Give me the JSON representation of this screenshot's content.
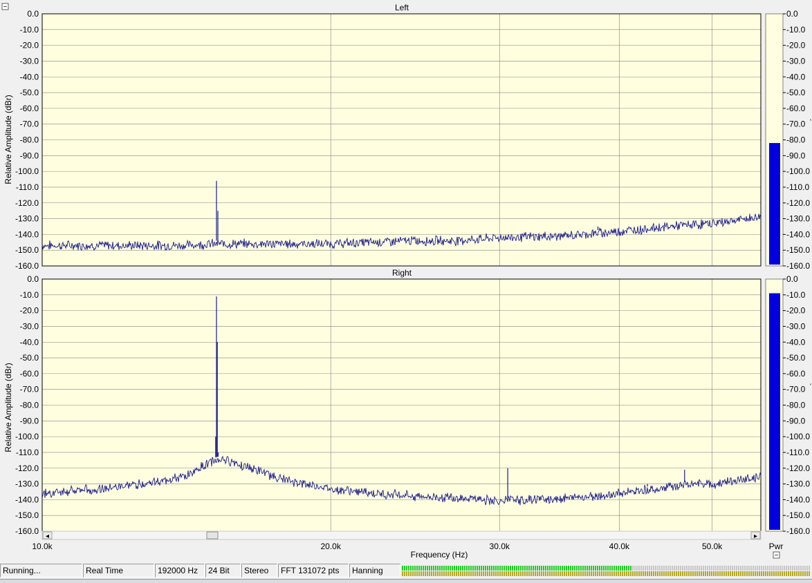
{
  "window": {
    "collapse_glyph": "−",
    "bottom_toggle_glyph": "−",
    "scroll_left_glyph": "◂",
    "scroll_right_glyph": "▸",
    "power_label": "Pwr",
    "xlabel": "Frequency (Hz)",
    "x_tick_labels": [
      "10.0k",
      "20.0k",
      "30.0k",
      "40.0k",
      "50.0k"
    ]
  },
  "colors": {
    "plot_background": "#ffffe0",
    "panel_background": "#f0f0f0",
    "grid": "#808080",
    "trace": "#1a1a8c",
    "meter_bar": "#0000e0",
    "level_green": "#22cc22",
    "level_olive": "#b4a824"
  },
  "status": {
    "running": "Running...",
    "mode": "Real Time",
    "sample_rate": "192000 Hz",
    "bit_depth": "24 Bit",
    "channels": "Stereo",
    "fft_size": "FFT 131072 pts",
    "window_fn": "Hanning",
    "input_level_fraction": 0.56
  },
  "chart_data": [
    {
      "type": "line",
      "title": "Left",
      "xlabel": "Frequency (Hz)",
      "ylabel": "Relative Amplitude (dBr)",
      "xlim": [
        10000,
        56200
      ],
      "ylim": [
        -160,
        0
      ],
      "x_scale": "log",
      "grid": true,
      "x_ticks": [
        10000,
        20000,
        30000,
        40000,
        50000
      ],
      "y_tick_labels": [
        "0.0",
        "-10.0",
        "-20.0",
        "-30.0",
        "-40.0",
        "-50.0",
        "-60.0",
        "-70.0",
        "-80.0",
        "-90.0",
        "-100.0",
        "-110.0",
        "-120.0",
        "-130.0",
        "-140.0",
        "-150.0",
        "-160.0"
      ],
      "series": [
        {
          "points": [
            [
              10000,
              -147
            ],
            [
              12000,
              -147
            ],
            [
              14000,
              -147
            ],
            [
              15000,
              -146
            ],
            [
              15200,
              -106
            ],
            [
              15400,
              -146
            ],
            [
              17000,
              -146
            ],
            [
              20000,
              -146
            ],
            [
              24000,
              -144
            ],
            [
              27000,
              -144
            ],
            [
              30000,
              -142
            ],
            [
              35000,
              -141
            ],
            [
              38000,
              -139
            ],
            [
              40000,
              -138
            ],
            [
              45000,
              -135
            ],
            [
              50000,
              -133
            ],
            [
              53000,
              -131
            ],
            [
              56000,
              -129
            ]
          ],
          "spikes": [
            [
              15200,
              -106
            ],
            [
              15250,
              -125
            ],
            [
              38000,
              -135
            ],
            [
              30300,
              -140
            ]
          ]
        }
      ],
      "power_meter": {
        "level_db": -82,
        "tick_labels": [
          "0.0",
          "-10.0",
          "-20.0",
          "-30.0",
          "-40.0",
          "-50.0",
          "-60.0",
          "-70.0",
          "-80.0",
          "-90.0",
          "-100.0",
          "-110.0",
          "-120.0",
          "-130.0",
          "-140.0",
          "-150.0",
          "-160.0"
        ]
      }
    },
    {
      "type": "line",
      "title": "Right",
      "xlabel": "Frequency (Hz)",
      "ylabel": "Relative Amplitude (dBr)",
      "xlim": [
        10000,
        56200
      ],
      "ylim": [
        -160,
        0
      ],
      "x_scale": "log",
      "grid": true,
      "x_ticks": [
        10000,
        20000,
        30000,
        40000,
        50000
      ],
      "y_tick_labels": [
        "0.0",
        "-10.0",
        "-20.0",
        "-30.0",
        "-40.0",
        "-50.0",
        "-60.0",
        "-70.0",
        "-80.0",
        "-90.0",
        "-100.0",
        "-110.0",
        "-120.0",
        "-130.0",
        "-140.0",
        "-150.0",
        "-160.0"
      ],
      "series": [
        {
          "points": [
            [
              10000,
              -136
            ],
            [
              11000,
              -134
            ],
            [
              12000,
              -132
            ],
            [
              13000,
              -129
            ],
            [
              14000,
              -126
            ],
            [
              14500,
              -121
            ],
            [
              15000,
              -116
            ],
            [
              15200,
              -11
            ],
            [
              15400,
              -114
            ],
            [
              16000,
              -117
            ],
            [
              17000,
              -123
            ],
            [
              18000,
              -128
            ],
            [
              20000,
              -133
            ],
            [
              22000,
              -136
            ],
            [
              25000,
              -138
            ],
            [
              28000,
              -139
            ],
            [
              30000,
              -141
            ],
            [
              32000,
              -140
            ],
            [
              35000,
              -139
            ],
            [
              38000,
              -138
            ],
            [
              40000,
              -136
            ],
            [
              42000,
              -134
            ],
            [
              44000,
              -133
            ],
            [
              46000,
              -131
            ],
            [
              48000,
              -130
            ],
            [
              50000,
              -130
            ],
            [
              53000,
              -128
            ],
            [
              56000,
              -126
            ]
          ],
          "spikes": [
            [
              15200,
              -11
            ],
            [
              15230,
              -40
            ],
            [
              15170,
              -100
            ],
            [
              15260,
              -110
            ],
            [
              30600,
              -120
            ],
            [
              46800,
              -121
            ],
            [
              42800,
              -130
            ]
          ]
        }
      ],
      "power_meter": {
        "level_db": -9,
        "tick_labels": [
          "0.0",
          "-10.0",
          "-20.0",
          "-30.0",
          "-40.0",
          "-50.0",
          "-60.0",
          "-70.0",
          "-80.0",
          "-90.0",
          "-100.0",
          "-110.0",
          "-120.0",
          "-130.0",
          "-140.0",
          "-150.0",
          "-160.0"
        ]
      }
    }
  ]
}
